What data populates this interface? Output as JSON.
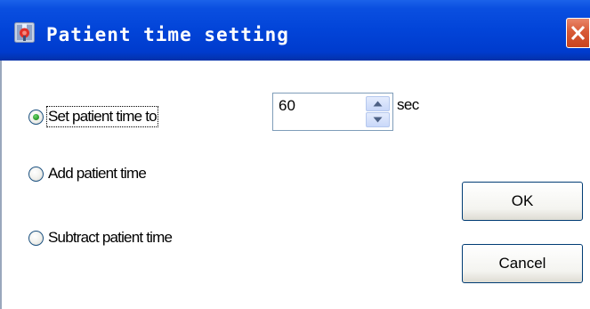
{
  "window": {
    "title": "Patient time setting"
  },
  "options": [
    {
      "label": "Set patient time to",
      "selected": true
    },
    {
      "label": "Add patient time",
      "selected": false
    },
    {
      "label": "Subtract patient time",
      "selected": false
    }
  ],
  "time_input": {
    "value": "60",
    "unit": "sec"
  },
  "buttons": {
    "ok_label": "OK",
    "cancel_label": "Cancel"
  },
  "colors": {
    "titlebar": "#0244d8",
    "close_button": "#d85a36",
    "radio_selected_dot": "#2fa12f"
  }
}
